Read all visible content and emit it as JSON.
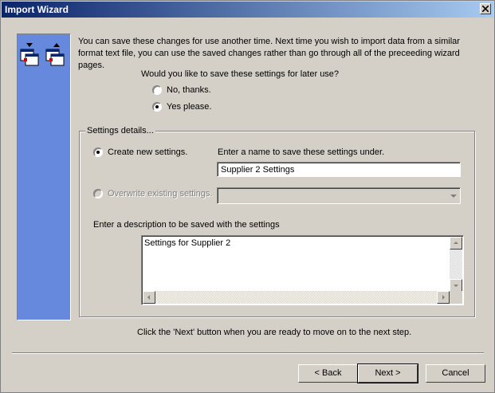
{
  "window": {
    "title": "Import Wizard"
  },
  "intro_text": "You can save these changes for use another time.  Next time you wish to import data from a similar format text file, you can use the saved changes rather than go through all of the preceeding wizard pages.",
  "question": "Would you like to save these settings for later use?",
  "save_options": [
    {
      "label": "No, thanks.",
      "selected": false
    },
    {
      "label": "Yes please.",
      "selected": true
    }
  ],
  "settings_group": {
    "legend": "Settings details...",
    "create_new_label": "Create new settings.",
    "create_new_selected": true,
    "name_prompt": "Enter a name to save these settings under.",
    "name_value": "Supplier 2 Settings",
    "overwrite_label": "Overwrite existing settings.",
    "overwrite_enabled": false,
    "existing_value": "",
    "description_prompt": "Enter a description to be saved with the settings",
    "description_value": "Settings for Supplier 2"
  },
  "footer_hint": "Click the 'Next' button when you are ready to move on to the next step.",
  "buttons": {
    "back": "< Back",
    "next": "Next >",
    "cancel": "Cancel"
  },
  "colors": {
    "titlebar_start": "#0a246a",
    "side_panel": "#6688dd",
    "face": "#d4d0c8"
  }
}
